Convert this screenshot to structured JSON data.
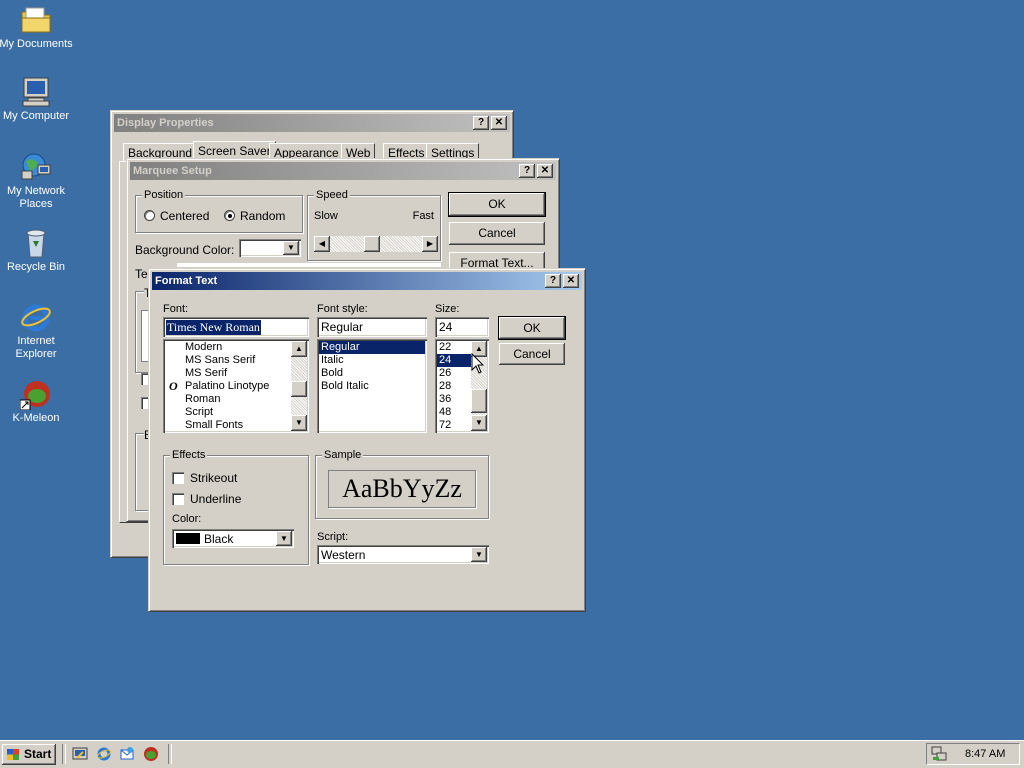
{
  "desktop": {
    "icons": [
      {
        "label": "My Documents",
        "icon": "folder-icon"
      },
      {
        "label": "My Computer",
        "icon": "computer-icon"
      },
      {
        "label": "My Network Places",
        "icon": "network-icon"
      },
      {
        "label": "Recycle Bin",
        "icon": "recycle-bin-icon"
      },
      {
        "label": "Internet Explorer",
        "icon": "internet-explorer-icon"
      },
      {
        "label": "K-Meleon",
        "icon": "kmeleon-icon"
      }
    ]
  },
  "display_properties": {
    "title": "Display Properties",
    "tabs": [
      "Background",
      "Screen Saver",
      "Appearance",
      "Web",
      "Effects",
      "Settings"
    ],
    "active_tab": "Screen Saver"
  },
  "marquee_setup": {
    "title": "Marquee Setup",
    "position_label": "Position",
    "centered_label": "Centered",
    "random_label": "Random",
    "speed_label": "Speed",
    "slow_label": "Slow",
    "fast_label": "Fast",
    "background_color_label": "Background Color:",
    "ok_label": "OK",
    "cancel_label": "Cancel",
    "format_text_label": "Format Text...",
    "partial_te": "Te",
    "partial_t": "T",
    "partial_e": "E"
  },
  "format_text": {
    "title": "Format Text",
    "font_label": "Font:",
    "font_value": "Times New Roman",
    "fonts": [
      "Modern",
      "MS Sans Serif",
      "MS Serif",
      "Palatino Linotype",
      "Roman",
      "Script",
      "Small Fonts"
    ],
    "style_label": "Font style:",
    "style_value": "Regular",
    "styles": [
      "Regular",
      "Italic",
      "Bold",
      "Bold Italic"
    ],
    "size_label": "Size:",
    "size_value": "24",
    "sizes": [
      "22",
      "24",
      "26",
      "28",
      "36",
      "48",
      "72"
    ],
    "ok_label": "OK",
    "cancel_label": "Cancel",
    "effects_label": "Effects",
    "strikeout_label": "Strikeout",
    "underline_label": "Underline",
    "color_label": "Color:",
    "color_value": "Black",
    "sample_label": "Sample",
    "sample_text": "AaBbYyZz",
    "script_label": "Script:",
    "script_value": "Western",
    "palatino_glyph": "O"
  },
  "title_buttons": {
    "help": "?",
    "close": "✕"
  },
  "taskbar": {
    "start_label": "Start",
    "clock": "8:47 AM"
  }
}
